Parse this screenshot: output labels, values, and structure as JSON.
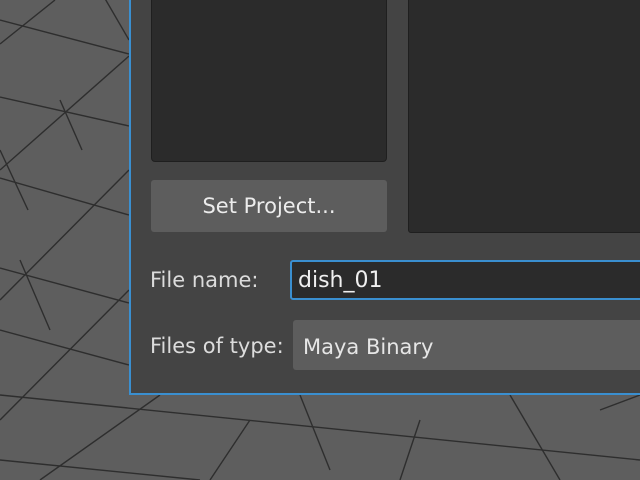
{
  "dialog": {
    "set_project_label": "Set Project...",
    "file_name_label": "File name:",
    "file_name_value": "dish_01",
    "file_type_label": "Files of type:",
    "file_type_value": "Maya Binary"
  },
  "colors": {
    "accent": "#3a8fd0",
    "dialog_bg": "#444444",
    "panel_bg": "#2b2b2b",
    "viewport_bg": "#5e5e5e"
  }
}
